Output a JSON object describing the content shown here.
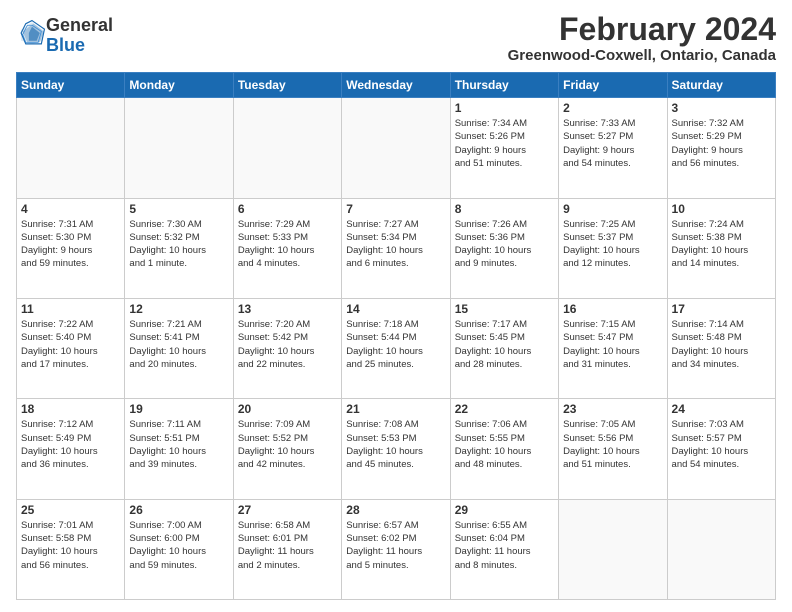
{
  "logo": {
    "general": "General",
    "blue": "Blue"
  },
  "header": {
    "title": "February 2024",
    "subtitle": "Greenwood-Coxwell, Ontario, Canada"
  },
  "weekdays": [
    "Sunday",
    "Monday",
    "Tuesday",
    "Wednesday",
    "Thursday",
    "Friday",
    "Saturday"
  ],
  "weeks": [
    [
      {
        "day": "",
        "info": ""
      },
      {
        "day": "",
        "info": ""
      },
      {
        "day": "",
        "info": ""
      },
      {
        "day": "",
        "info": ""
      },
      {
        "day": "1",
        "info": "Sunrise: 7:34 AM\nSunset: 5:26 PM\nDaylight: 9 hours\nand 51 minutes."
      },
      {
        "day": "2",
        "info": "Sunrise: 7:33 AM\nSunset: 5:27 PM\nDaylight: 9 hours\nand 54 minutes."
      },
      {
        "day": "3",
        "info": "Sunrise: 7:32 AM\nSunset: 5:29 PM\nDaylight: 9 hours\nand 56 minutes."
      }
    ],
    [
      {
        "day": "4",
        "info": "Sunrise: 7:31 AM\nSunset: 5:30 PM\nDaylight: 9 hours\nand 59 minutes."
      },
      {
        "day": "5",
        "info": "Sunrise: 7:30 AM\nSunset: 5:32 PM\nDaylight: 10 hours\nand 1 minute."
      },
      {
        "day": "6",
        "info": "Sunrise: 7:29 AM\nSunset: 5:33 PM\nDaylight: 10 hours\nand 4 minutes."
      },
      {
        "day": "7",
        "info": "Sunrise: 7:27 AM\nSunset: 5:34 PM\nDaylight: 10 hours\nand 6 minutes."
      },
      {
        "day": "8",
        "info": "Sunrise: 7:26 AM\nSunset: 5:36 PM\nDaylight: 10 hours\nand 9 minutes."
      },
      {
        "day": "9",
        "info": "Sunrise: 7:25 AM\nSunset: 5:37 PM\nDaylight: 10 hours\nand 12 minutes."
      },
      {
        "day": "10",
        "info": "Sunrise: 7:24 AM\nSunset: 5:38 PM\nDaylight: 10 hours\nand 14 minutes."
      }
    ],
    [
      {
        "day": "11",
        "info": "Sunrise: 7:22 AM\nSunset: 5:40 PM\nDaylight: 10 hours\nand 17 minutes."
      },
      {
        "day": "12",
        "info": "Sunrise: 7:21 AM\nSunset: 5:41 PM\nDaylight: 10 hours\nand 20 minutes."
      },
      {
        "day": "13",
        "info": "Sunrise: 7:20 AM\nSunset: 5:42 PM\nDaylight: 10 hours\nand 22 minutes."
      },
      {
        "day": "14",
        "info": "Sunrise: 7:18 AM\nSunset: 5:44 PM\nDaylight: 10 hours\nand 25 minutes."
      },
      {
        "day": "15",
        "info": "Sunrise: 7:17 AM\nSunset: 5:45 PM\nDaylight: 10 hours\nand 28 minutes."
      },
      {
        "day": "16",
        "info": "Sunrise: 7:15 AM\nSunset: 5:47 PM\nDaylight: 10 hours\nand 31 minutes."
      },
      {
        "day": "17",
        "info": "Sunrise: 7:14 AM\nSunset: 5:48 PM\nDaylight: 10 hours\nand 34 minutes."
      }
    ],
    [
      {
        "day": "18",
        "info": "Sunrise: 7:12 AM\nSunset: 5:49 PM\nDaylight: 10 hours\nand 36 minutes."
      },
      {
        "day": "19",
        "info": "Sunrise: 7:11 AM\nSunset: 5:51 PM\nDaylight: 10 hours\nand 39 minutes."
      },
      {
        "day": "20",
        "info": "Sunrise: 7:09 AM\nSunset: 5:52 PM\nDaylight: 10 hours\nand 42 minutes."
      },
      {
        "day": "21",
        "info": "Sunrise: 7:08 AM\nSunset: 5:53 PM\nDaylight: 10 hours\nand 45 minutes."
      },
      {
        "day": "22",
        "info": "Sunrise: 7:06 AM\nSunset: 5:55 PM\nDaylight: 10 hours\nand 48 minutes."
      },
      {
        "day": "23",
        "info": "Sunrise: 7:05 AM\nSunset: 5:56 PM\nDaylight: 10 hours\nand 51 minutes."
      },
      {
        "day": "24",
        "info": "Sunrise: 7:03 AM\nSunset: 5:57 PM\nDaylight: 10 hours\nand 54 minutes."
      }
    ],
    [
      {
        "day": "25",
        "info": "Sunrise: 7:01 AM\nSunset: 5:58 PM\nDaylight: 10 hours\nand 56 minutes."
      },
      {
        "day": "26",
        "info": "Sunrise: 7:00 AM\nSunset: 6:00 PM\nDaylight: 10 hours\nand 59 minutes."
      },
      {
        "day": "27",
        "info": "Sunrise: 6:58 AM\nSunset: 6:01 PM\nDaylight: 11 hours\nand 2 minutes."
      },
      {
        "day": "28",
        "info": "Sunrise: 6:57 AM\nSunset: 6:02 PM\nDaylight: 11 hours\nand 5 minutes."
      },
      {
        "day": "29",
        "info": "Sunrise: 6:55 AM\nSunset: 6:04 PM\nDaylight: 11 hours\nand 8 minutes."
      },
      {
        "day": "",
        "info": ""
      },
      {
        "day": "",
        "info": ""
      }
    ]
  ]
}
